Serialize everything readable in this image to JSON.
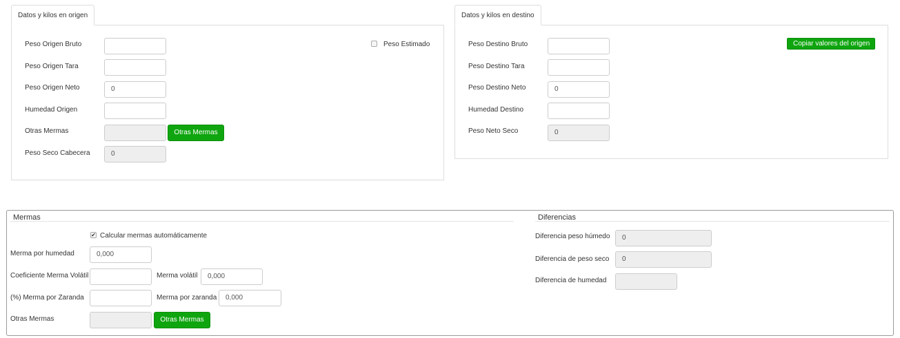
{
  "origen": {
    "tab_label": "Datos y kilos en origen",
    "peso_bruto": {
      "label": "Peso Origen Bruto",
      "value": ""
    },
    "peso_tara": {
      "label": "Peso Origen Tara",
      "value": ""
    },
    "peso_neto": {
      "label": "Peso Origen Neto",
      "value": "0"
    },
    "humedad": {
      "label": "Humedad Origen",
      "value": ""
    },
    "otras_mermas": {
      "label": "Otras Mermas",
      "value": "",
      "button_label": "Otras Mermas"
    },
    "peso_seco": {
      "label": "Peso Seco Cabecera",
      "value": "0"
    },
    "peso_estimado": {
      "label": "Peso Estimado",
      "checked": false
    }
  },
  "destino": {
    "tab_label": "Datos y kilos en destino",
    "peso_bruto": {
      "label": "Peso Destino Bruto",
      "value": ""
    },
    "peso_tara": {
      "label": "Peso Destino Tara",
      "value": ""
    },
    "peso_neto": {
      "label": "Peso Destino Neto",
      "value": "0"
    },
    "humedad": {
      "label": "Humedad Destino",
      "value": ""
    },
    "peso_neto_seco": {
      "label": "Peso Neto Seco",
      "value": "0"
    },
    "copy_button_label": "Copiar valores del origen"
  },
  "mermas": {
    "legend": "Mermas",
    "auto_calc": {
      "label": "Calcular mermas automáticamente",
      "checked": true
    },
    "merma_humedad": {
      "label": "Merma por humedad",
      "value": "0,000"
    },
    "coef_volatil": {
      "label": "Coeficiente Merma Volátil",
      "value": ""
    },
    "merma_volatil": {
      "label": "Merma volátil",
      "value": "0,000"
    },
    "pct_zaranda": {
      "label": "(%) Merma por Zaranda",
      "value": ""
    },
    "merma_zaranda": {
      "label": "Merma por zaranda",
      "value": "0,000"
    },
    "otras_mermas": {
      "label": "Otras Mermas",
      "value": "",
      "button_label": "Otras Mermas"
    }
  },
  "diferencias": {
    "legend": "Diferencias",
    "peso_humedo": {
      "label": "Diferencia peso húmedo",
      "value": "0"
    },
    "peso_seco": {
      "label": "Diferencia de peso seco",
      "value": "0"
    },
    "humedad": {
      "label": "Diferencia de humedad",
      "value": ""
    }
  },
  "colors": {
    "button_green": "#0fa50f",
    "panel_border": "#dddddd",
    "fieldset_border": "#999999",
    "readonly_bg": "#eeeeee"
  }
}
